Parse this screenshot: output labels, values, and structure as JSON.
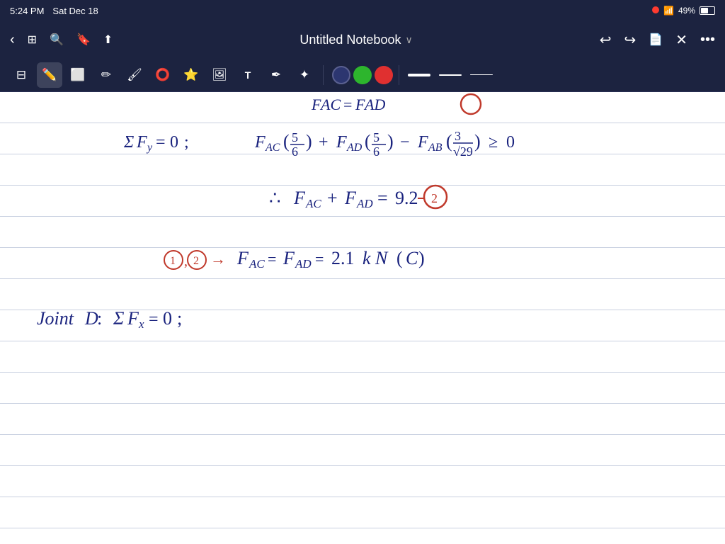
{
  "statusBar": {
    "time": "5:24 PM",
    "date": "Sat Dec 18",
    "battery": "49%",
    "recording": true
  },
  "titleBar": {
    "title": "Untitled Notebook",
    "chevron": "›",
    "backLabel": "‹",
    "undoLabel": "↩",
    "redoLabel": "↪"
  },
  "toolbar": {
    "tools": [
      "sidebar",
      "pen",
      "eraser",
      "pencil",
      "brush",
      "lasso",
      "shape",
      "star",
      "image",
      "text",
      "marker",
      "expand"
    ],
    "colors": [
      "dark",
      "green",
      "red"
    ],
    "strokes": [
      "thick",
      "medium",
      "thin"
    ]
  },
  "notebook": {
    "title": "Untitled Notebook"
  }
}
